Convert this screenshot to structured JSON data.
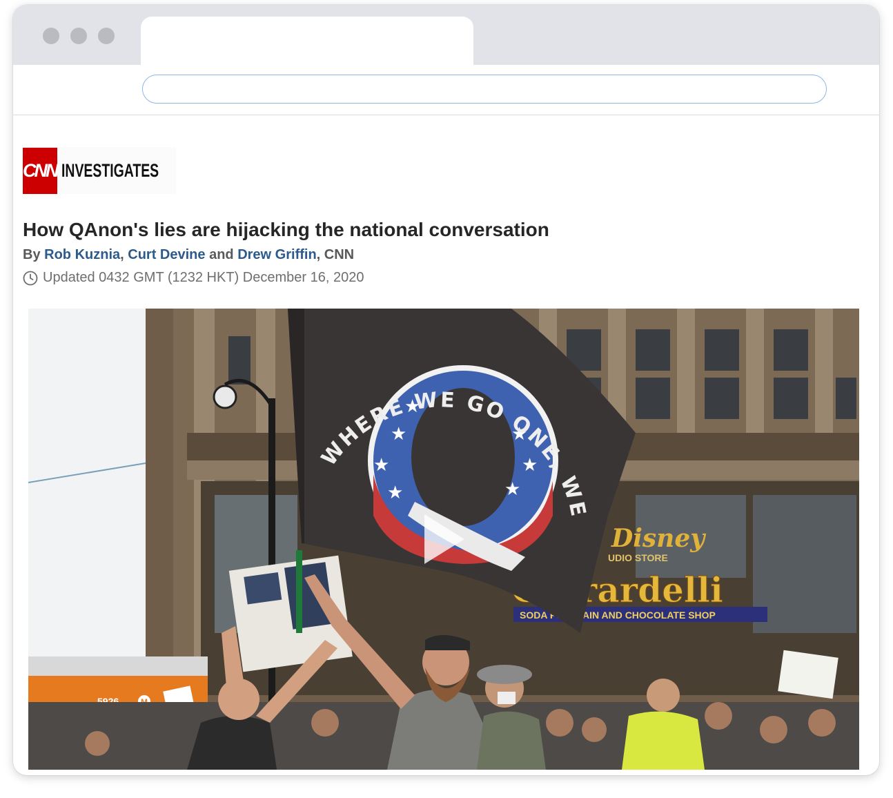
{
  "browser": {
    "tab_title": "",
    "url": ""
  },
  "logo": {
    "brand": "CNN",
    "section": "INVESTIGATES",
    "brand_color": "#cc0000"
  },
  "article": {
    "headline": "How QAnon's lies are hijacking the national conversation",
    "byline": {
      "prefix": "By",
      "authors": [
        "Rob Kuznia",
        "Curt Devine",
        "Drew Griffin"
      ],
      "separator1": ",",
      "conjunction": "and",
      "outlet": ", CNN"
    },
    "updated": "Updated 0432 GMT (1232 HKT) December 16, 2020",
    "link_color": "#2c5a8c"
  },
  "media": {
    "type": "video",
    "play_icon": "play-icon",
    "flag_text": "WHERE WE GO ONE, WE GO ALL!",
    "signage": {
      "disney": "Disney",
      "studio_store": "UDIO STORE",
      "ghirardelli": "Ghirardelli",
      "ghirardelli_sub": "SODA FOUNTAIN AND CHOCOLATE SHOP",
      "bus_number": "5926",
      "bus_line": "M"
    }
  },
  "icons": {
    "clock": "clock-icon",
    "window_controls": [
      "close-dot-icon",
      "minimize-dot-icon",
      "zoom-dot-icon"
    ]
  }
}
